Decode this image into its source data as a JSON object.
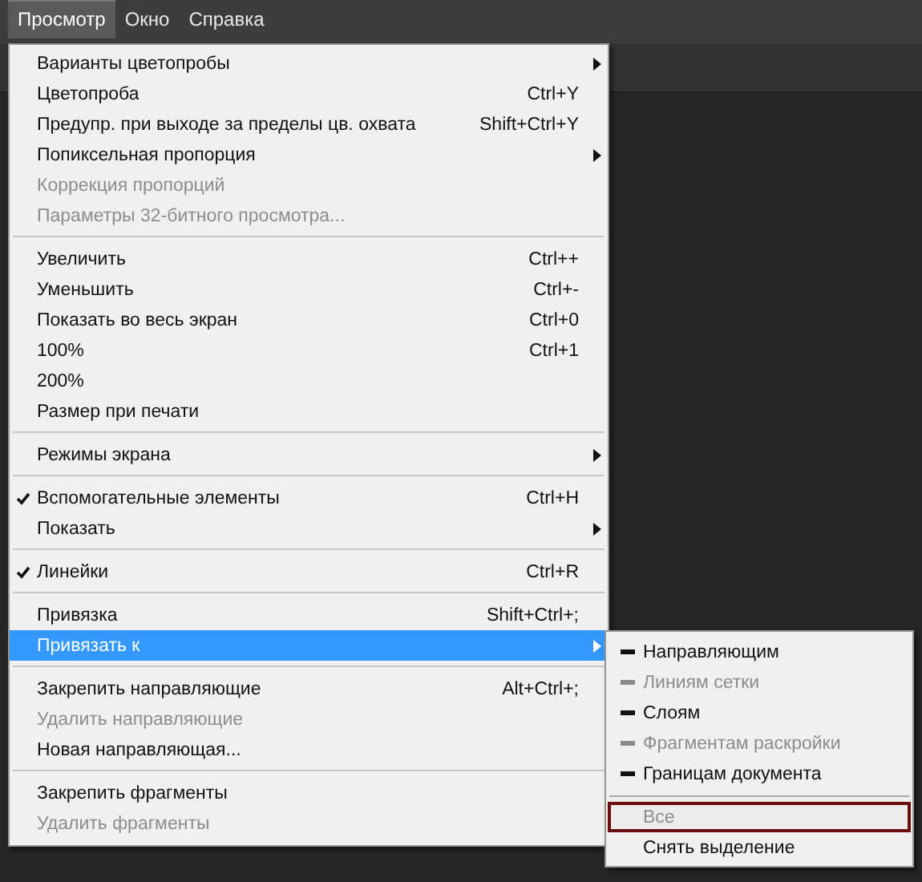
{
  "menu_bar": [
    {
      "label": "Просмотр",
      "selected": true
    },
    {
      "label": "Окно",
      "selected": false
    },
    {
      "label": "Справка",
      "selected": false
    }
  ],
  "menu": {
    "groups": [
      [
        {
          "label": "Варианты цветопробы",
          "checked": false,
          "disabled": false,
          "submenu": true,
          "selected": false
        },
        {
          "label": "Цветопроба",
          "shortcut": "Ctrl+Y",
          "checked": false,
          "disabled": false,
          "submenu": false,
          "selected": false
        },
        {
          "label": "Предупр. при выходе за пределы цв. охвата",
          "shortcut": "Shift+Ctrl+Y",
          "checked": false,
          "disabled": false,
          "submenu": false,
          "selected": false
        },
        {
          "label": "Попиксельная пропорция",
          "checked": false,
          "disabled": false,
          "submenu": true,
          "selected": false
        },
        {
          "label": "Коррекция пропорций",
          "checked": false,
          "disabled": true,
          "submenu": false,
          "selected": false
        },
        {
          "label": "Параметры 32-битного просмотра...",
          "checked": false,
          "disabled": true,
          "submenu": false,
          "selected": false
        }
      ],
      [
        {
          "label": "Увеличить",
          "shortcut": "Ctrl++",
          "checked": false,
          "disabled": false,
          "submenu": false,
          "selected": false
        },
        {
          "label": "Уменьшить",
          "shortcut": "Ctrl+-",
          "checked": false,
          "disabled": false,
          "submenu": false,
          "selected": false
        },
        {
          "label": "Показать во весь экран",
          "shortcut": "Ctrl+0",
          "checked": false,
          "disabled": false,
          "submenu": false,
          "selected": false
        },
        {
          "label": "100%",
          "shortcut": "Ctrl+1",
          "checked": false,
          "disabled": false,
          "submenu": false,
          "selected": false
        },
        {
          "label": "200%",
          "checked": false,
          "disabled": false,
          "submenu": false,
          "selected": false
        },
        {
          "label": "Размер при печати",
          "checked": false,
          "disabled": false,
          "submenu": false,
          "selected": false
        }
      ],
      [
        {
          "label": "Режимы экрана",
          "checked": false,
          "disabled": false,
          "submenu": true,
          "selected": false
        }
      ],
      [
        {
          "label": "Вспомогательные элементы",
          "shortcut": "Ctrl+H",
          "checked": true,
          "disabled": false,
          "submenu": false,
          "selected": false
        },
        {
          "label": "Показать",
          "checked": false,
          "disabled": false,
          "submenu": true,
          "selected": false
        }
      ],
      [
        {
          "label": "Линейки",
          "shortcut": "Ctrl+R",
          "checked": true,
          "disabled": false,
          "submenu": false,
          "selected": false
        }
      ],
      [
        {
          "label": "Привязка",
          "shortcut": "Shift+Ctrl+;",
          "checked": false,
          "disabled": false,
          "submenu": false,
          "selected": false
        },
        {
          "label": "Привязать к",
          "checked": false,
          "disabled": false,
          "submenu": true,
          "selected": true
        }
      ],
      [
        {
          "label": "Закрепить направляющие",
          "shortcut": "Alt+Ctrl+;",
          "checked": false,
          "disabled": false,
          "submenu": false,
          "selected": false
        },
        {
          "label": "Удалить направляющие",
          "checked": false,
          "disabled": true,
          "submenu": false,
          "selected": false
        },
        {
          "label": "Новая направляющая...",
          "checked": false,
          "disabled": false,
          "submenu": false,
          "selected": false
        }
      ],
      [
        {
          "label": "Закрепить фрагменты",
          "checked": false,
          "disabled": false,
          "submenu": false,
          "selected": false
        },
        {
          "label": "Удалить фрагменты",
          "checked": false,
          "disabled": true,
          "submenu": false,
          "selected": false
        }
      ]
    ]
  },
  "submenu": {
    "groups": [
      [
        {
          "label": "Направляющим",
          "checked": true,
          "disabled": false,
          "selected": false
        },
        {
          "label": "Линиям сетки",
          "checked": true,
          "disabled": true,
          "selected": false
        },
        {
          "label": "Слоям",
          "checked": true,
          "disabled": false,
          "selected": false
        },
        {
          "label": "Фрагментам раскройки",
          "checked": true,
          "disabled": true,
          "selected": false
        },
        {
          "label": "Границам документа",
          "checked": true,
          "disabled": false,
          "selected": false
        }
      ],
      [
        {
          "label": "Все",
          "checked": false,
          "disabled": true,
          "selected": true
        },
        {
          "label": "Снять выделение",
          "checked": false,
          "disabled": false,
          "selected": false
        }
      ]
    ]
  }
}
